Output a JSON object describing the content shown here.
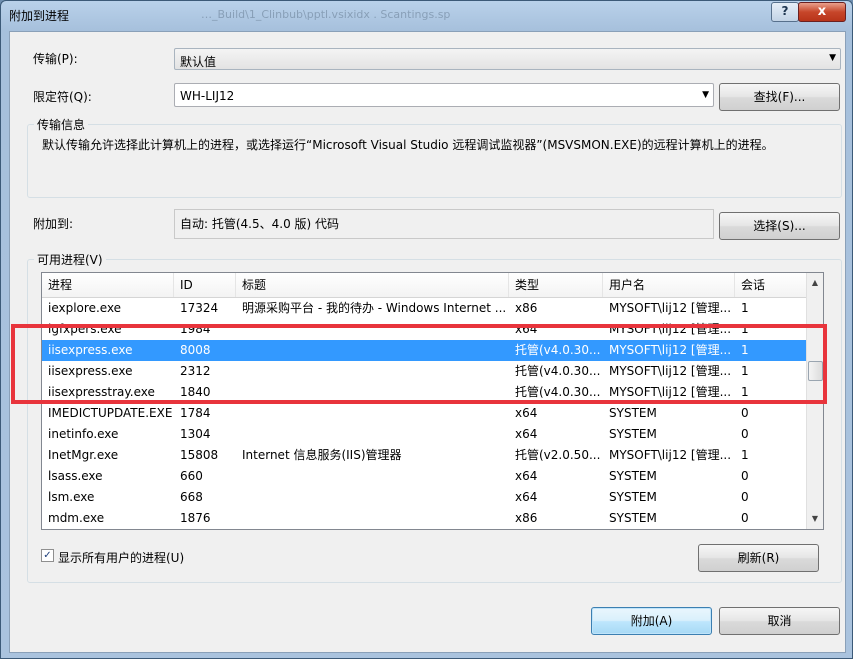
{
  "window": {
    "title": "附加到进程",
    "ghost_title": "…_Build\\1_Clinbub\\pptl.vsixidx . Scantings.sp",
    "help_glyph": "?",
    "close_glyph": "x"
  },
  "transport": {
    "label": "传输(P):",
    "value": "默认值"
  },
  "qualifier": {
    "label": "限定符(Q):",
    "value": "WH-LIJ12",
    "find_button": "查找(F)..."
  },
  "transport_info": {
    "caption": "传输信息",
    "text": "默认传输允许选择此计算机上的进程，或选择运行“Microsoft Visual Studio 远程调试监视器”(MSVSMON.EXE)的远程计算机上的进程。"
  },
  "attach_to": {
    "label": "附加到:",
    "value": "自动: 托管(4.5、4.0 版) 代码",
    "select_button": "选择(S)..."
  },
  "processes": {
    "caption": "可用进程(V)",
    "columns": [
      "进程",
      "ID",
      "标题",
      "类型",
      "用户名",
      "会话"
    ],
    "rows": [
      [
        "iexplore.exe",
        "17324",
        "明源采购平台 - 我的待办 - Windows Internet ...",
        "x86",
        "MYSOFT\\lij12 [管理...",
        "1"
      ],
      [
        "igfxpers.exe",
        "1984",
        "",
        "x64",
        "MYSOFT\\lij12 [管理...",
        "1"
      ],
      [
        "iisexpress.exe",
        "8008",
        "",
        "托管(v4.0.30...",
        "MYSOFT\\lij12 [管理...",
        "1"
      ],
      [
        "iisexpress.exe",
        "2312",
        "",
        "托管(v4.0.30...",
        "MYSOFT\\lij12 [管理...",
        "1"
      ],
      [
        "iisexpresstray.exe",
        "1840",
        "",
        "托管(v4.0.30...",
        "MYSOFT\\lij12 [管理...",
        "1"
      ],
      [
        "IMEDICTUPDATE.EXE",
        "1784",
        "",
        "x64",
        "SYSTEM",
        "0"
      ],
      [
        "inetinfo.exe",
        "1304",
        "",
        "x64",
        "SYSTEM",
        "0"
      ],
      [
        "InetMgr.exe",
        "15808",
        "Internet 信息服务(IIS)管理器",
        "托管(v2.0.50...",
        "MYSOFT\\lij12 [管理...",
        "1"
      ],
      [
        "lsass.exe",
        "660",
        "",
        "x64",
        "SYSTEM",
        "0"
      ],
      [
        "lsm.exe",
        "668",
        "",
        "x64",
        "SYSTEM",
        "0"
      ],
      [
        "mdm.exe",
        "1876",
        "",
        "x86",
        "SYSTEM",
        "0"
      ]
    ],
    "selected_row": 2,
    "show_all_users": {
      "label": "显示所有用户的进程(U)",
      "checked": true,
      "glyph": "✓"
    },
    "refresh_button": "刷新(R)"
  },
  "actions": {
    "attach_button": "附加(A)",
    "cancel_button": "取消"
  },
  "colors": {
    "selection": "#3399ff",
    "highlight_box": "#e8343c"
  }
}
